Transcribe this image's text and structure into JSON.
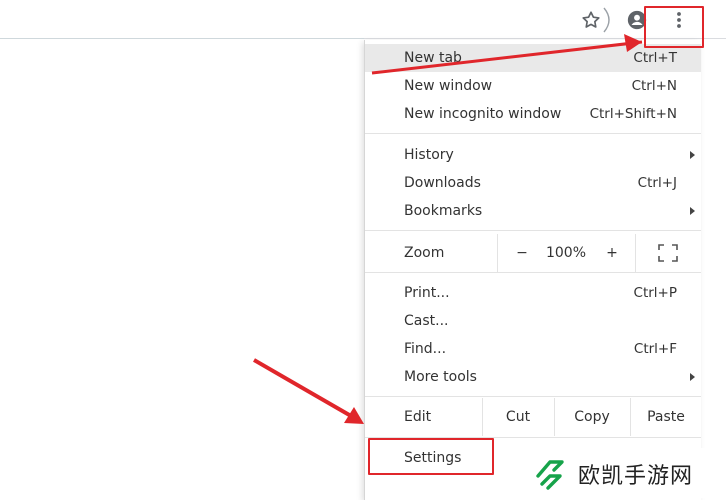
{
  "toolbar": {
    "star_icon": "star-icon",
    "account_icon": "account-icon",
    "menu_icon": "kebab-menu-icon"
  },
  "menu": {
    "group1": [
      {
        "label": "New tab",
        "shortcut": "Ctrl+T",
        "underline_index": 0
      },
      {
        "label": "New window",
        "shortcut": "Ctrl+N",
        "underline_index": 0
      },
      {
        "label": "New incognito window",
        "shortcut": "Ctrl+Shift+N",
        "underline_index": 4
      }
    ],
    "group2": [
      {
        "label": "History",
        "has_submenu": true
      },
      {
        "label": "Downloads",
        "shortcut": "Ctrl+J"
      },
      {
        "label": "Bookmarks",
        "has_submenu": true
      }
    ],
    "zoom": {
      "label": "Zoom",
      "minus": "−",
      "value": "100%",
      "plus": "+"
    },
    "group3": [
      {
        "label": "Print...",
        "shortcut": "Ctrl+P"
      },
      {
        "label": "Cast..."
      },
      {
        "label": "Find...",
        "shortcut": "Ctrl+F"
      },
      {
        "label": "More tools",
        "has_submenu": true
      }
    ],
    "edit": {
      "label": "Edit",
      "cut": "Cut",
      "copy": "Copy",
      "paste": "Paste"
    },
    "settings": {
      "label": "Settings"
    }
  },
  "watermark": {
    "text": "欧凯手游网",
    "color": "#16a34a"
  },
  "colors": {
    "highlight": "#e0262b",
    "active_row": "#e9e9e9"
  }
}
